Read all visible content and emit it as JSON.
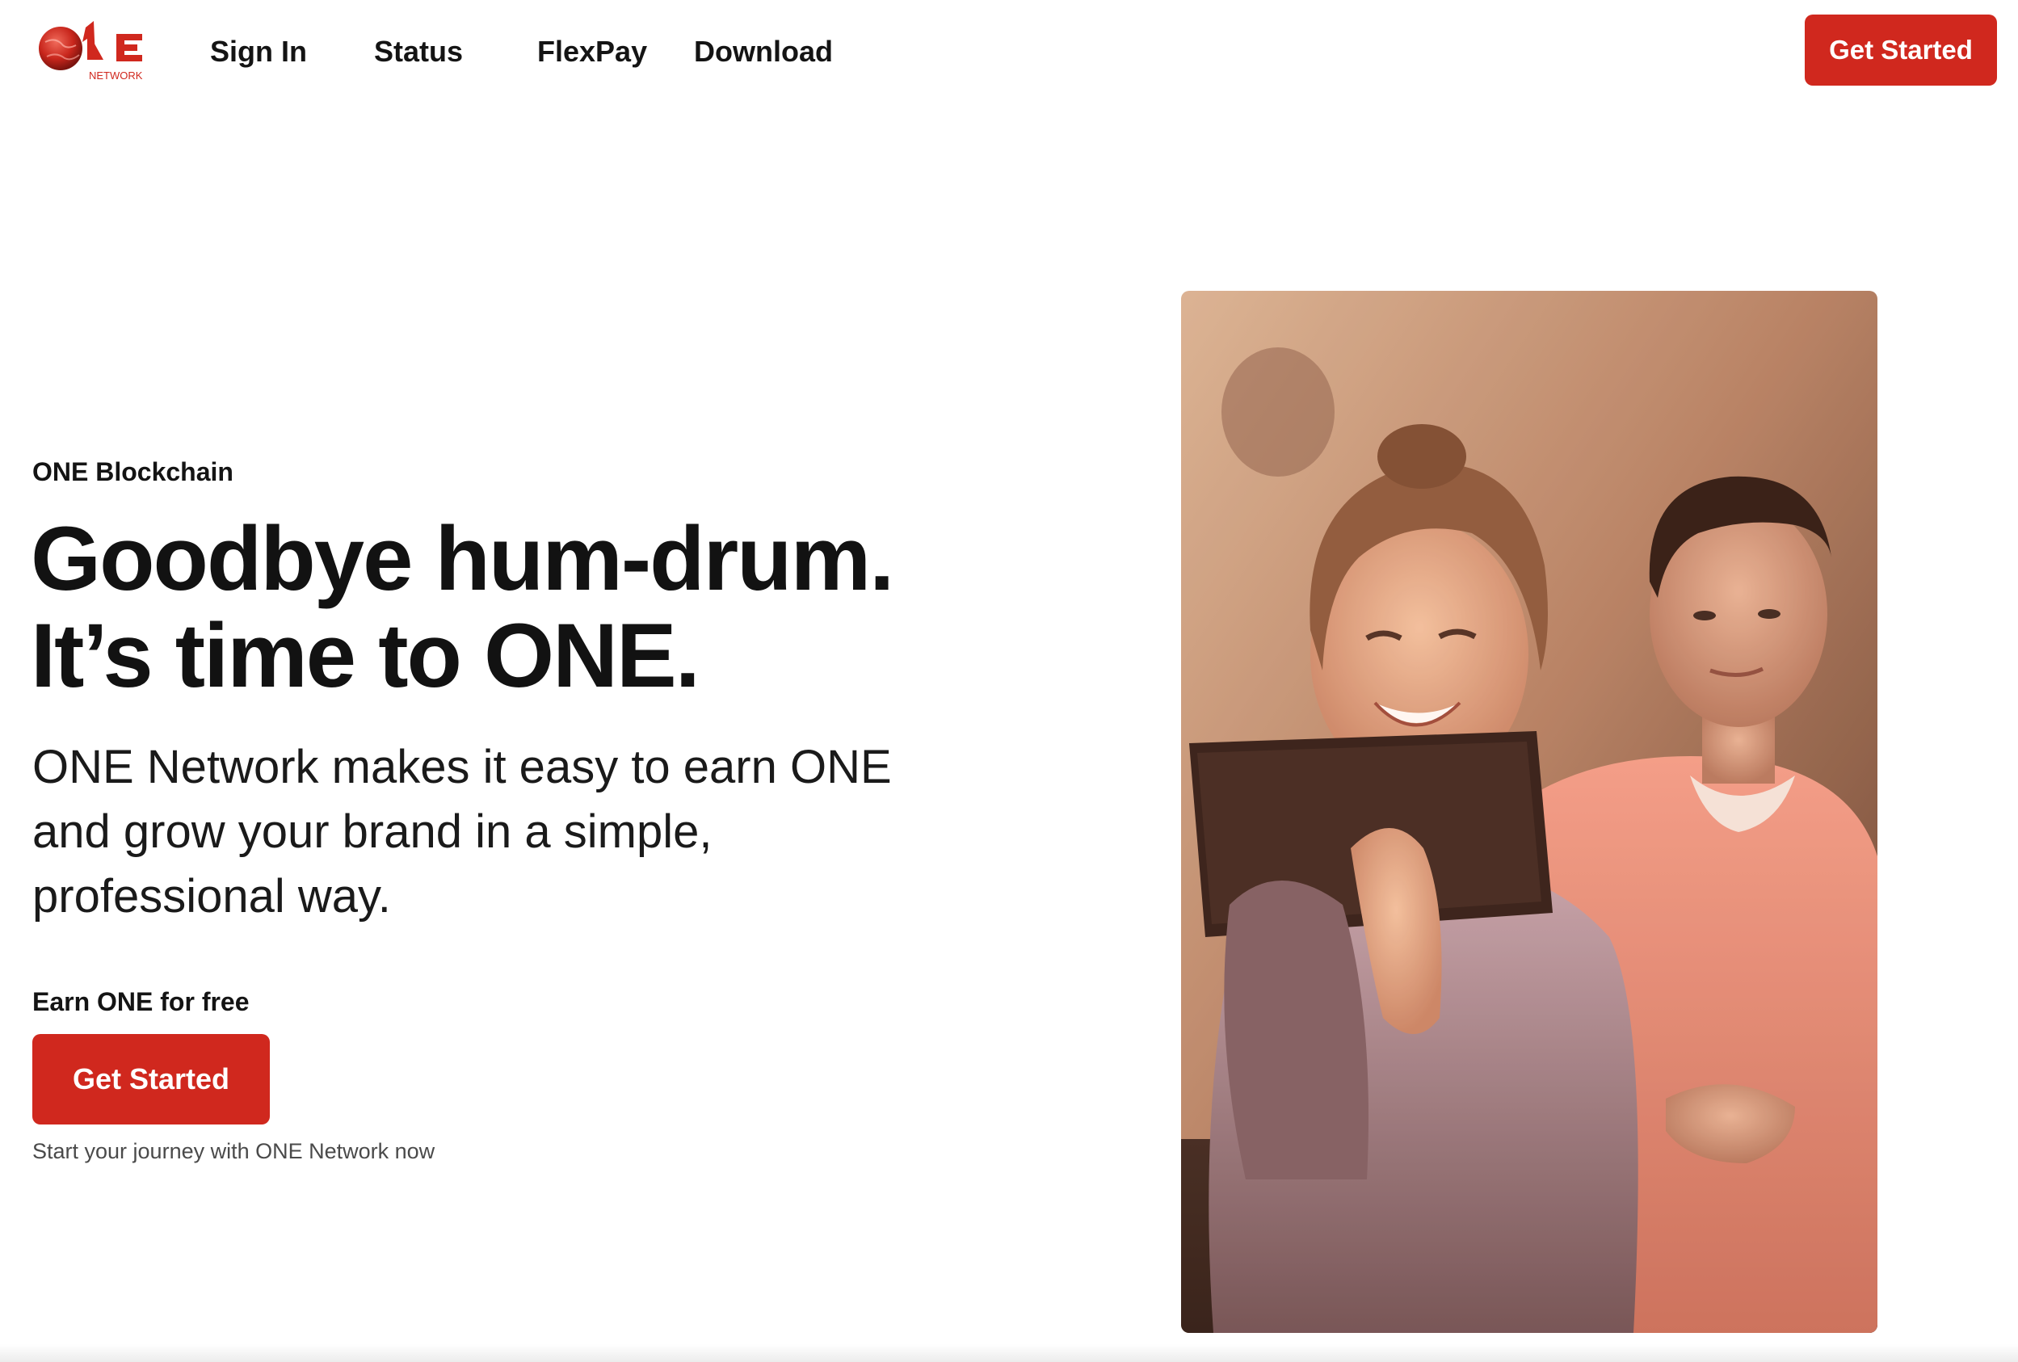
{
  "brand": {
    "logo_text": "ONE",
    "logo_subtext": "NETWORK",
    "accent_color": "#d0281e"
  },
  "nav": {
    "items": [
      {
        "label": "Sign In"
      },
      {
        "label": "Status"
      },
      {
        "label": "FlexPay"
      },
      {
        "label": "Download"
      }
    ],
    "cta_label": "Get Started"
  },
  "hero": {
    "eyebrow": "ONE Blockchain",
    "headline_line1": "Goodbye hum-drum.",
    "headline_line2": "It’s time to ONE.",
    "lede": "ONE Network makes it easy to earn ONE and grow your brand in a simple, professional way.",
    "earn_label": "Earn ONE for free",
    "cta_label": "Get Started",
    "subnote": "Start your journey with ONE Network now"
  },
  "image": {
    "subject": "photo of two smiling people looking at a tablet"
  }
}
